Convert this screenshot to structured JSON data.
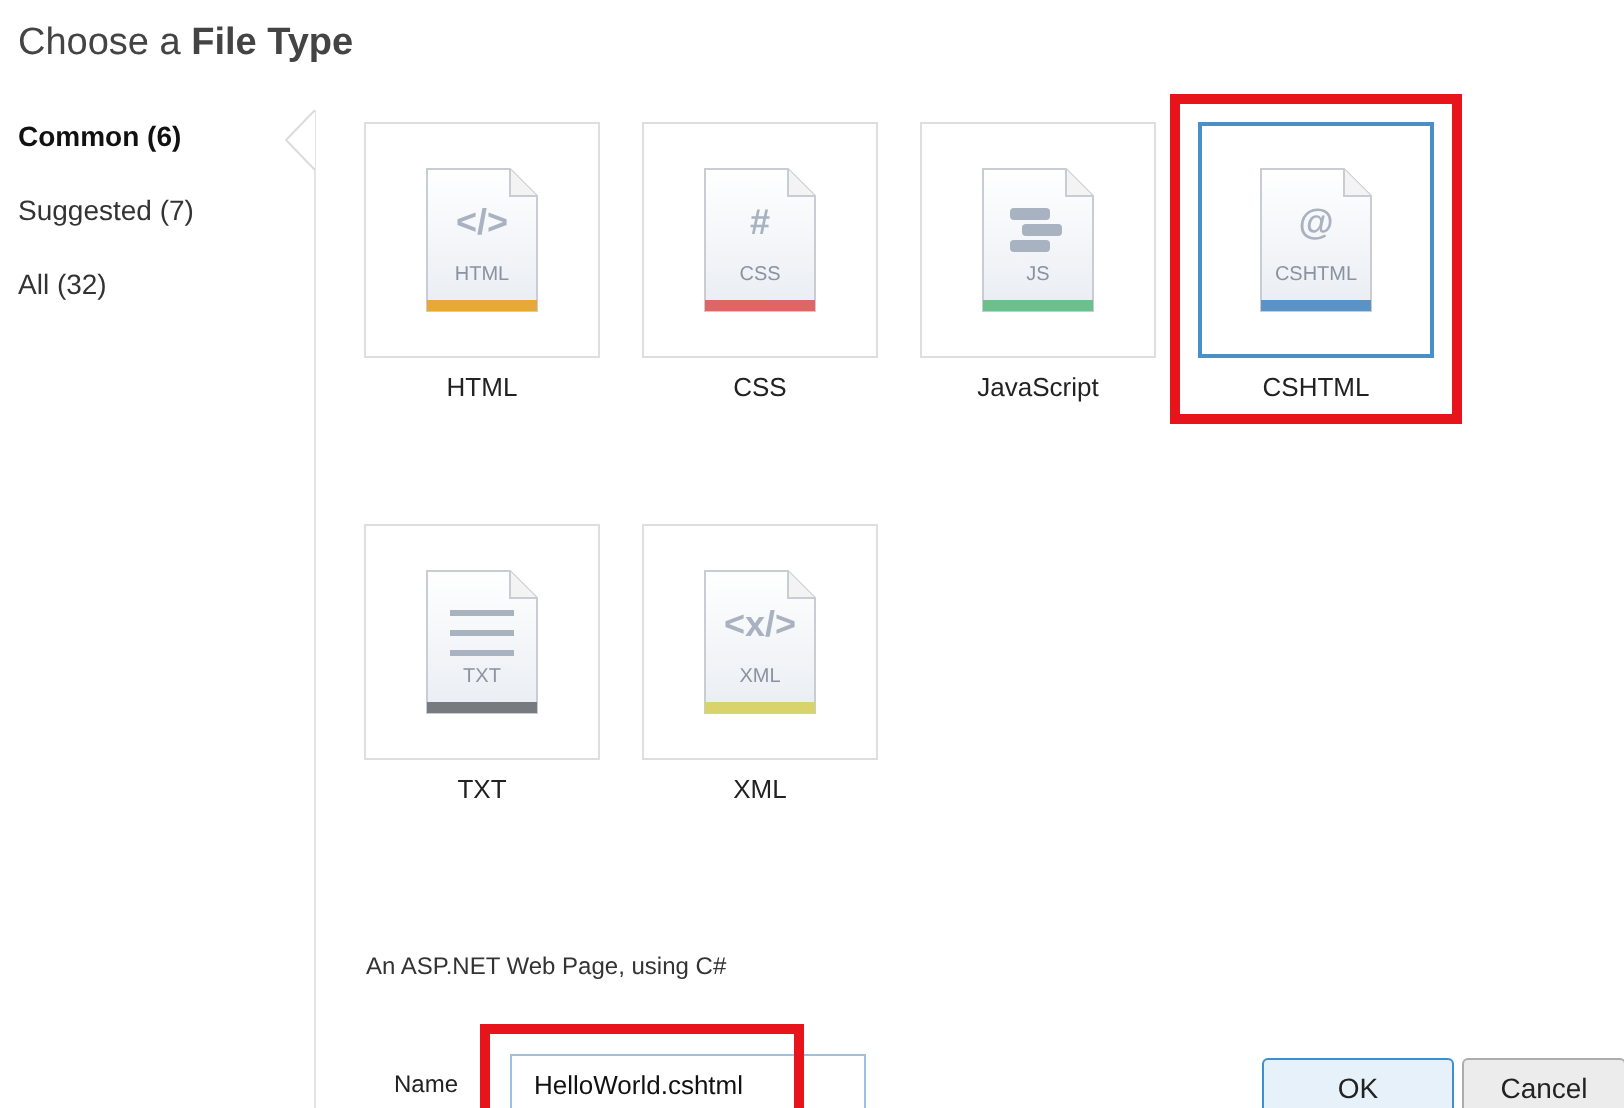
{
  "title": "Choose a **File Type**",
  "categories": [
    {
      "label": "Common (6)",
      "selected": true
    },
    {
      "label": "Suggested (7)",
      "selected": false
    },
    {
      "label": "All (32)",
      "selected": false
    }
  ],
  "file_types": [
    {
      "label": "HTML",
      "badge": "HTML",
      "kind": "symbol",
      "symbol": "</>",
      "color": "#e8a838",
      "selected": false,
      "highlighted": false
    },
    {
      "label": "CSS",
      "badge": "CSS",
      "kind": "symbol",
      "symbol": "#",
      "color": "#e06666",
      "selected": false,
      "highlighted": false
    },
    {
      "label": "JavaScript",
      "badge": "JS",
      "kind": "stack",
      "color": "#6cc08b",
      "selected": false,
      "highlighted": false
    },
    {
      "label": "CSHTML",
      "badge": "CSHTML",
      "kind": "symbol",
      "symbol": "@",
      "color": "#5b93c7",
      "selected": true,
      "highlighted": true
    },
    {
      "label": "TXT",
      "badge": "TXT",
      "kind": "lines",
      "color": "#777b80",
      "selected": false,
      "highlighted": false
    },
    {
      "label": "XML",
      "badge": "XML",
      "kind": "symbol",
      "symbol": "<x/>",
      "color": "#d8d36a",
      "selected": false,
      "highlighted": false
    }
  ],
  "description": "An ASP.NET Web Page, using C#",
  "name_field": {
    "label": "Name",
    "value": "HelloWorld.cshtml",
    "highlighted": true
  },
  "buttons": [
    {
      "label": "OK",
      "default": true
    },
    {
      "label": "Cancel",
      "default": false
    }
  ]
}
